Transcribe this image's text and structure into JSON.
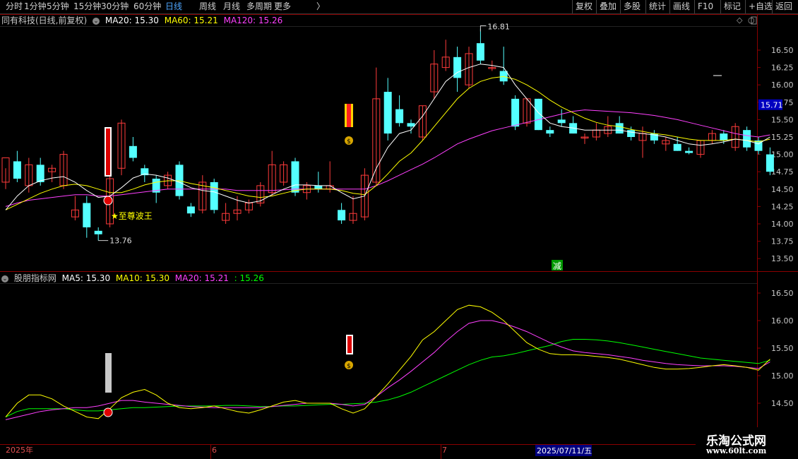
{
  "toolbar": {
    "left": [
      "分时",
      "1分钟",
      "5分钟",
      "15分钟",
      "30分钟",
      "60分钟",
      "日线",
      "周线",
      "月线",
      "多周期",
      "更多"
    ],
    "active_index": 6,
    "more_arrow": "〉",
    "right": [
      "复权",
      "叠加",
      "多股",
      "统计",
      "画线",
      "F10",
      "标记",
      "+自选",
      "返回"
    ]
  },
  "main_header": {
    "title": "同有科技(日线,前复权)",
    "ma20": "MA20: 15.30",
    "ma60": "MA60: 15.21",
    "ma120": "MA120: 15.26"
  },
  "sub_header": {
    "title": "股朋指标网",
    "ma5": "MA5: 15.30",
    "ma10": "MA10: 15.30",
    "ma20": "MA20: 15.21",
    "extra": ": 15.26"
  },
  "annotations": {
    "high_label": "16.81",
    "low_label": "13.76",
    "signal_text": "★至尊波王",
    "reduce_text": "减",
    "money_icon": "money-bag-icon",
    "ball_icon": "red-ball-icon"
  },
  "price_axis": {
    "ticks": [
      "16.50",
      "16.25",
      "16.00",
      "15.75",
      "15.50",
      "15.25",
      "15.00",
      "14.75",
      "14.50",
      "14.25",
      "14.00",
      "13.75",
      "13.50"
    ],
    "current": "15.71"
  },
  "sub_axis": {
    "ticks": [
      "16.50",
      "16.00",
      "15.50",
      "15.00",
      "14.50"
    ]
  },
  "date_axis": {
    "labels": [
      "2025年",
      "6",
      "7"
    ],
    "cursor_date": "2025/07/11/五"
  },
  "watermark": {
    "line1": "乐淘公式网",
    "line2": "www.60lt.com"
  },
  "colors": {
    "up": "#ff3b3b",
    "down": "#54ffff",
    "ma_white": "#ffffff",
    "ma_yellow": "#ffff00",
    "ma_magenta": "#ff40ff",
    "ma_green": "#00ff00",
    "grid": "#8b0000",
    "axis_text": "#c8c8c8",
    "active_tab": "#4ea6ff"
  },
  "chart_data": {
    "type": "candlestick",
    "candles": [
      {
        "o": 14.6,
        "h": 14.8,
        "l": 14.5,
        "c": 14.95
      },
      {
        "o": 14.9,
        "h": 15.05,
        "l": 14.6,
        "c": 14.65
      },
      {
        "o": 14.55,
        "h": 14.95,
        "l": 14.45,
        "c": 14.85
      },
      {
        "o": 14.85,
        "h": 14.95,
        "l": 14.55,
        "c": 14.6
      },
      {
        "o": 14.75,
        "h": 14.85,
        "l": 14.6,
        "c": 14.8
      },
      {
        "o": 14.55,
        "h": 15.05,
        "l": 14.5,
        "c": 15.0
      },
      {
        "o": 14.1,
        "h": 14.4,
        "l": 14.05,
        "c": 14.2
      },
      {
        "o": 14.3,
        "h": 14.4,
        "l": 13.8,
        "c": 13.95
      },
      {
        "o": 13.9,
        "h": 13.95,
        "l": 13.76,
        "c": 13.85
      },
      {
        "o": 14.0,
        "h": 14.8,
        "l": 13.95,
        "c": 14.65
      },
      {
        "o": 14.8,
        "h": 15.5,
        "l": 14.7,
        "c": 15.45
      },
      {
        "o": 15.12,
        "h": 15.25,
        "l": 14.9,
        "c": 14.95
      },
      {
        "o": 14.8,
        "h": 14.85,
        "l": 14.6,
        "c": 14.7
      },
      {
        "o": 14.65,
        "h": 14.7,
        "l": 14.3,
        "c": 14.45
      },
      {
        "o": 14.55,
        "h": 14.75,
        "l": 14.5,
        "c": 14.7
      },
      {
        "o": 14.85,
        "h": 14.9,
        "l": 14.35,
        "c": 14.4
      },
      {
        "o": 14.25,
        "h": 14.3,
        "l": 14.1,
        "c": 14.15
      },
      {
        "o": 14.2,
        "h": 14.7,
        "l": 14.15,
        "c": 14.6
      },
      {
        "o": 14.6,
        "h": 14.65,
        "l": 14.15,
        "c": 14.2
      },
      {
        "o": 14.05,
        "h": 14.3,
        "l": 14.0,
        "c": 14.15
      },
      {
        "o": 14.15,
        "h": 14.4,
        "l": 14.05,
        "c": 14.2
      },
      {
        "o": 14.2,
        "h": 14.35,
        "l": 14.15,
        "c": 14.3
      },
      {
        "o": 14.3,
        "h": 14.6,
        "l": 14.25,
        "c": 14.55
      },
      {
        "o": 14.45,
        "h": 15.05,
        "l": 14.4,
        "c": 14.85
      },
      {
        "o": 14.6,
        "h": 14.9,
        "l": 14.55,
        "c": 14.85
      },
      {
        "o": 14.9,
        "h": 14.95,
        "l": 14.4,
        "c": 14.45
      },
      {
        "o": 14.45,
        "h": 14.6,
        "l": 14.35,
        "c": 14.55
      },
      {
        "o": 14.55,
        "h": 14.75,
        "l": 14.45,
        "c": 14.5
      },
      {
        "o": 14.5,
        "h": 14.9,
        "l": 14.45,
        "c": 14.55
      },
      {
        "o": 14.2,
        "h": 14.3,
        "l": 14.0,
        "c": 14.05
      },
      {
        "o": 14.05,
        "h": 14.4,
        "l": 14.0,
        "c": 14.15
      },
      {
        "o": 14.1,
        "h": 14.8,
        "l": 14.05,
        "c": 14.7
      },
      {
        "o": 14.6,
        "h": 16.25,
        "l": 14.55,
        "c": 15.8
      },
      {
        "o": 15.9,
        "h": 16.1,
        "l": 15.2,
        "c": 15.3
      },
      {
        "o": 15.65,
        "h": 15.85,
        "l": 15.4,
        "c": 15.45
      },
      {
        "o": 15.45,
        "h": 15.5,
        "l": 15.3,
        "c": 15.4
      },
      {
        "o": 15.25,
        "h": 15.7,
        "l": 15.2,
        "c": 15.7
      },
      {
        "o": 15.9,
        "h": 16.5,
        "l": 15.8,
        "c": 16.3
      },
      {
        "o": 16.25,
        "h": 16.65,
        "l": 16.2,
        "c": 16.4
      },
      {
        "o": 16.4,
        "h": 16.55,
        "l": 15.9,
        "c": 16.1
      },
      {
        "o": 16.0,
        "h": 16.55,
        "l": 15.95,
        "c": 16.45
      },
      {
        "o": 16.6,
        "h": 16.81,
        "l": 16.3,
        "c": 16.35
      },
      {
        "o": 16.25,
        "h": 16.35,
        "l": 16.2,
        "c": 16.25
      },
      {
        "o": 16.2,
        "h": 16.55,
        "l": 16.0,
        "c": 16.05
      },
      {
        "o": 15.8,
        "h": 15.85,
        "l": 15.35,
        "c": 15.4
      },
      {
        "o": 15.45,
        "h": 15.8,
        "l": 15.4,
        "c": 15.8
      },
      {
        "o": 15.8,
        "h": 15.8,
        "l": 15.35,
        "c": 15.35
      },
      {
        "o": 15.35,
        "h": 15.4,
        "l": 15.25,
        "c": 15.3
      },
      {
        "o": 15.5,
        "h": 15.65,
        "l": 15.4,
        "c": 15.45
      },
      {
        "o": 15.45,
        "h": 15.55,
        "l": 15.3,
        "c": 15.3
      },
      {
        "o": 15.25,
        "h": 15.3,
        "l": 15.15,
        "c": 15.25
      },
      {
        "o": 15.25,
        "h": 15.45,
        "l": 15.2,
        "c": 15.35
      },
      {
        "o": 15.3,
        "h": 15.55,
        "l": 15.25,
        "c": 15.4
      },
      {
        "o": 15.45,
        "h": 15.55,
        "l": 15.3,
        "c": 15.3
      },
      {
        "o": 15.35,
        "h": 15.4,
        "l": 15.2,
        "c": 15.25
      },
      {
        "o": 15.2,
        "h": 15.4,
        "l": 14.95,
        "c": 15.3
      },
      {
        "o": 15.3,
        "h": 15.35,
        "l": 15.15,
        "c": 15.2
      },
      {
        "o": 15.15,
        "h": 15.25,
        "l": 15.05,
        "c": 15.2
      },
      {
        "o": 15.15,
        "h": 15.25,
        "l": 15.05,
        "c": 15.05
      },
      {
        "o": 15.05,
        "h": 15.1,
        "l": 15.0,
        "c": 15.02
      },
      {
        "o": 15.0,
        "h": 15.2,
        "l": 14.95,
        "c": 15.2
      },
      {
        "o": 15.2,
        "h": 15.35,
        "l": 15.15,
        "c": 15.3
      },
      {
        "o": 15.3,
        "h": 15.35,
        "l": 15.15,
        "c": 15.2
      },
      {
        "o": 15.1,
        "h": 15.45,
        "l": 15.05,
        "c": 15.4
      },
      {
        "o": 15.35,
        "h": 15.4,
        "l": 15.05,
        "c": 15.1
      },
      {
        "o": 15.2,
        "h": 15.25,
        "l": 15.0,
        "c": 15.05
      },
      {
        "o": 15.0,
        "h": 15.1,
        "l": 14.7,
        "c": 14.75
      }
    ],
    "ma_main_white": [
      14.2,
      14.4,
      14.55,
      14.62,
      14.66,
      14.68,
      14.6,
      14.48,
      14.38,
      14.4,
      14.52,
      14.66,
      14.72,
      14.7,
      14.66,
      14.6,
      14.52,
      14.48,
      14.46,
      14.4,
      14.34,
      14.3,
      14.33,
      14.42,
      14.5,
      14.56,
      14.56,
      14.55,
      14.55,
      14.45,
      14.36,
      14.4,
      14.8,
      15.1,
      15.3,
      15.35,
      15.55,
      15.8,
      16.05,
      16.18,
      16.25,
      16.3,
      16.28,
      16.25,
      16.0,
      15.8,
      15.6,
      15.45,
      15.4,
      15.38,
      15.35,
      15.35,
      15.35,
      15.35,
      15.32,
      15.3,
      15.28,
      15.25,
      15.2,
      15.15,
      15.13,
      15.15,
      15.18,
      15.22,
      15.2,
      15.15,
      15.25
    ],
    "ma_main_yellow": [
      14.2,
      14.28,
      14.36,
      14.44,
      14.5,
      14.55,
      14.57,
      14.55,
      14.5,
      14.45,
      14.45,
      14.5,
      14.56,
      14.6,
      14.62,
      14.62,
      14.58,
      14.55,
      14.52,
      14.48,
      14.44,
      14.4,
      14.38,
      14.4,
      14.44,
      14.48,
      14.5,
      14.5,
      14.5,
      14.48,
      14.44,
      14.42,
      14.55,
      14.72,
      14.9,
      15.02,
      15.2,
      15.4,
      15.6,
      15.8,
      15.95,
      16.05,
      16.1,
      16.12,
      16.08,
      16.0,
      15.9,
      15.78,
      15.68,
      15.6,
      15.52,
      15.46,
      15.42,
      15.4,
      15.36,
      15.33,
      15.3,
      15.28,
      15.25,
      15.22,
      15.2,
      15.2,
      15.2,
      15.22,
      15.2,
      15.18,
      15.22
    ],
    "ma_main_magenta": [
      14.25,
      14.3,
      14.34,
      14.36,
      14.38,
      14.4,
      14.42,
      14.42,
      14.4,
      14.4,
      14.42,
      14.44,
      14.46,
      14.48,
      14.5,
      14.5,
      14.5,
      14.5,
      14.5,
      14.5,
      14.48,
      14.48,
      14.48,
      14.48,
      14.49,
      14.5,
      14.5,
      14.5,
      14.5,
      14.5,
      14.5,
      14.5,
      14.55,
      14.62,
      14.7,
      14.78,
      14.86,
      14.95,
      15.05,
      15.15,
      15.22,
      15.28,
      15.34,
      15.38,
      15.42,
      15.46,
      15.5,
      15.54,
      15.58,
      15.62,
      15.64,
      15.63,
      15.62,
      15.61,
      15.6,
      15.58,
      15.56,
      15.53,
      15.5,
      15.46,
      15.42,
      15.38,
      15.34,
      15.3,
      15.27,
      15.25,
      15.28
    ],
    "sub_yellow": [
      14.25,
      14.5,
      14.65,
      14.65,
      14.58,
      14.45,
      14.35,
      14.25,
      14.22,
      14.4,
      14.6,
      14.7,
      14.75,
      14.65,
      14.5,
      14.42,
      14.4,
      14.42,
      14.45,
      14.4,
      14.35,
      14.32,
      14.38,
      14.45,
      14.52,
      14.55,
      14.5,
      14.5,
      14.5,
      14.4,
      14.32,
      14.4,
      14.62,
      14.85,
      15.1,
      15.35,
      15.65,
      15.8,
      16.0,
      16.2,
      16.28,
      16.25,
      16.15,
      16.0,
      15.8,
      15.6,
      15.48,
      15.4,
      15.38,
      15.38,
      15.37,
      15.35,
      15.33,
      15.3,
      15.25,
      15.2,
      15.15,
      15.12,
      15.12,
      15.13,
      15.15,
      15.18,
      15.2,
      15.18,
      15.15,
      15.1,
      15.3
    ],
    "sub_magenta": [
      14.2,
      14.25,
      14.3,
      14.35,
      14.38,
      14.4,
      14.42,
      14.42,
      14.45,
      14.5,
      14.55,
      14.55,
      14.52,
      14.5,
      14.48,
      14.46,
      14.44,
      14.43,
      14.42,
      14.42,
      14.42,
      14.42,
      14.42,
      14.44,
      14.46,
      14.48,
      14.5,
      14.5,
      14.5,
      14.48,
      14.45,
      14.48,
      14.62,
      14.78,
      14.92,
      15.08,
      15.25,
      15.42,
      15.62,
      15.8,
      15.95,
      16.0,
      16.0,
      15.95,
      15.88,
      15.8,
      15.7,
      15.6,
      15.52,
      15.45,
      15.42,
      15.4,
      15.38,
      15.35,
      15.32,
      15.28,
      15.25,
      15.22,
      15.2,
      15.19,
      15.18,
      15.18,
      15.18,
      15.17,
      15.15,
      15.13,
      15.25
    ],
    "sub_green": [
      14.25,
      14.35,
      14.4,
      14.4,
      14.4,
      14.4,
      14.38,
      14.36,
      14.36,
      14.38,
      14.4,
      14.42,
      14.42,
      14.43,
      14.44,
      14.45,
      14.45,
      14.45,
      14.45,
      14.46,
      14.46,
      14.45,
      14.44,
      14.44,
      14.45,
      14.45,
      14.46,
      14.47,
      14.48,
      14.48,
      14.49,
      14.5,
      14.52,
      14.56,
      14.62,
      14.7,
      14.8,
      14.9,
      15.0,
      15.1,
      15.2,
      15.28,
      15.34,
      15.36,
      15.4,
      15.45,
      15.5,
      15.55,
      15.62,
      15.66,
      15.66,
      15.65,
      15.63,
      15.6,
      15.56,
      15.52,
      15.48,
      15.44,
      15.4,
      15.36,
      15.32,
      15.3,
      15.28,
      15.26,
      15.24,
      15.22,
      15.28
    ]
  }
}
